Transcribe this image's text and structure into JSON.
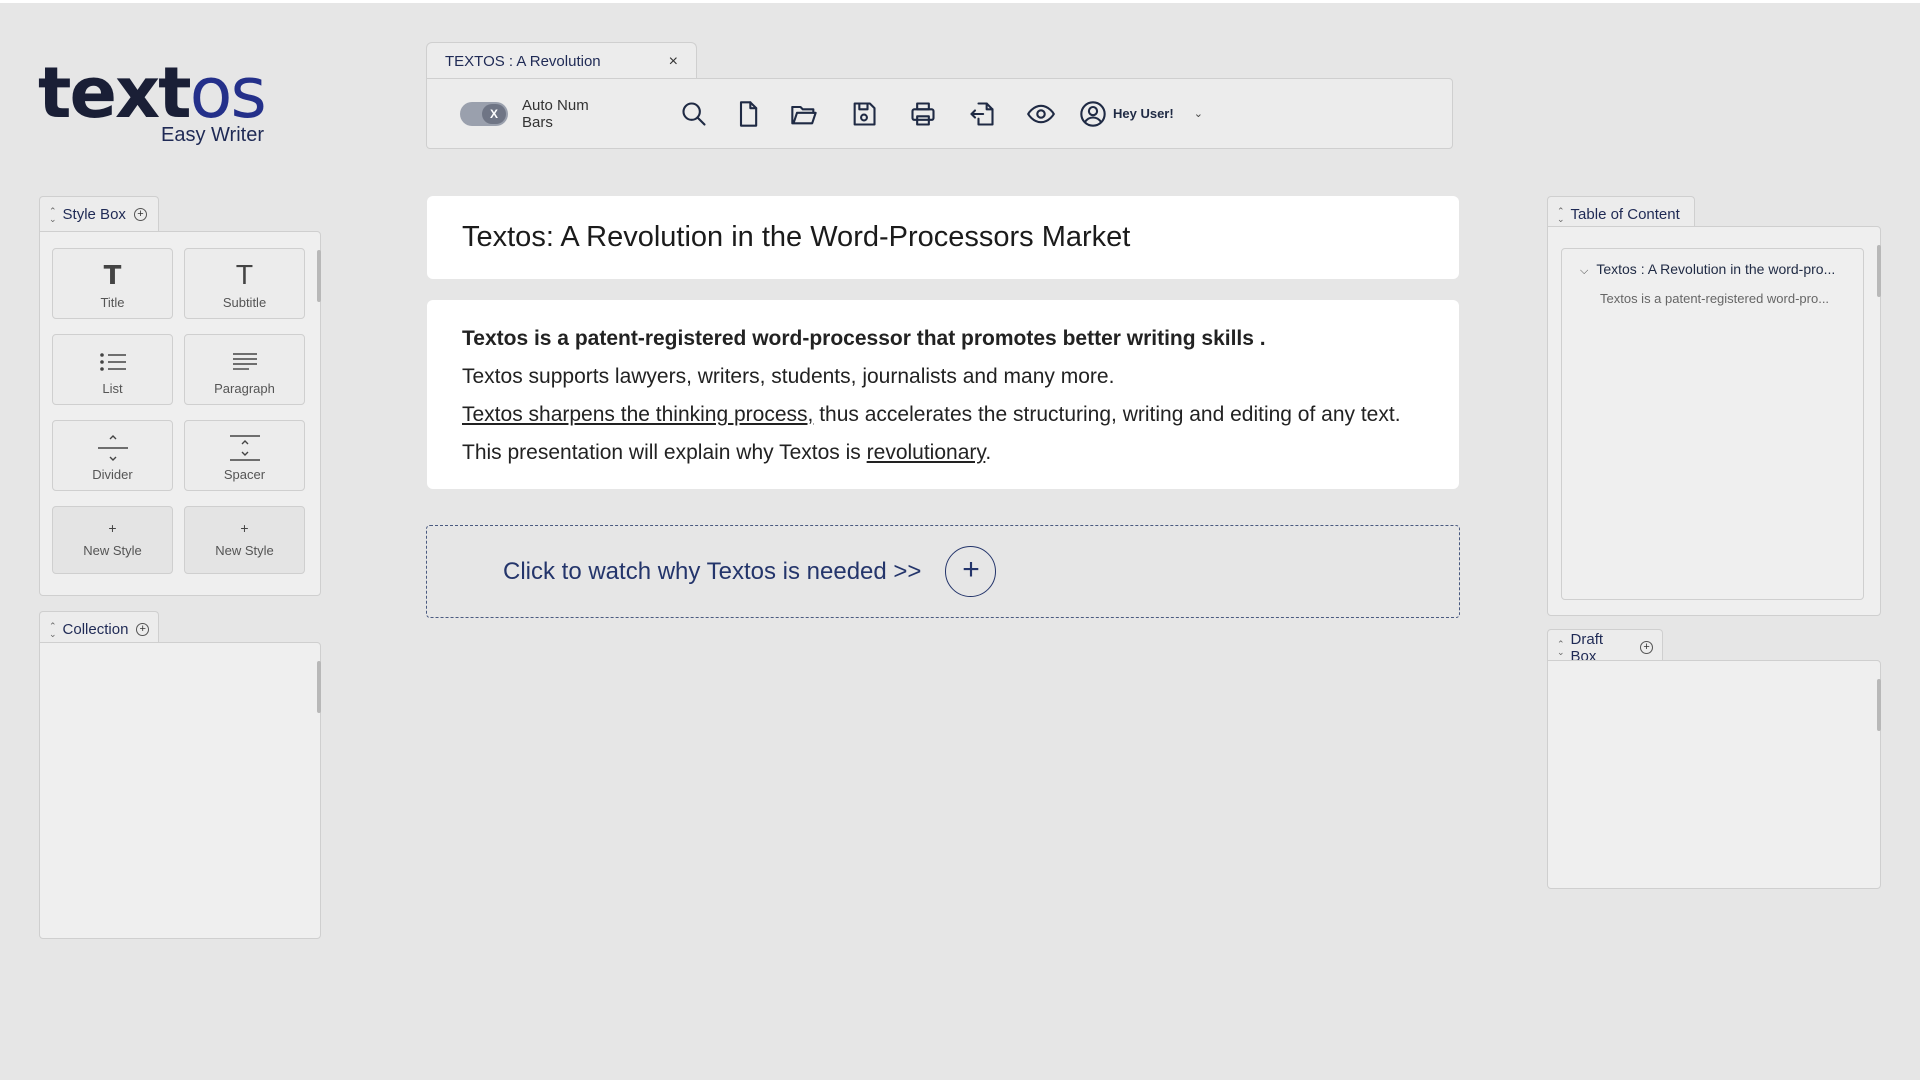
{
  "logo": {
    "word_dark": "text",
    "word_blue": "os",
    "subtitle": "Easy Writer"
  },
  "doc_tab": {
    "title": "TEXTOS : A Revolution",
    "close": "×"
  },
  "toolbar": {
    "toggle_knob": "X",
    "toggle_label": "Auto Num Bars",
    "icons": [
      "search-icon",
      "new-file-icon",
      "folder-open-icon",
      "save-icon",
      "print-icon",
      "export-icon",
      "preview-eye-icon"
    ],
    "user_name": "Hey User!",
    "user_chevron": "⌄"
  },
  "style_box": {
    "title": "Style Box",
    "buttons": [
      {
        "glyph": "T",
        "label": "Title"
      },
      {
        "glyph": "T",
        "label": "Subtitle"
      },
      {
        "label": "List"
      },
      {
        "label": "Paragraph"
      },
      {
        "label": "Divider"
      },
      {
        "label": "Spacer"
      },
      {
        "glyph": "+",
        "label": "New Style"
      },
      {
        "glyph": "+",
        "label": "New Style"
      }
    ]
  },
  "collection": {
    "title": "Collection"
  },
  "document": {
    "title": "Textos:  A Revolution in the Word-Processors Market",
    "lead": "Textos is a patent-registered word-processor that promotes better writing skills .",
    "line2": "Textos supports lawyers, writers, students, journalists and many more.",
    "line3_underlined": "Textos sharpens the thinking process,",
    "line3_rest": " thus accelerates the structuring, writing and editing of any text.",
    "line4_start": "This presentation will explain why Textos is ",
    "line4_underlined": "revolutionary",
    "line4_end": "."
  },
  "cta": {
    "text": "Click to watch why Textos is needed >>",
    "plus": "+"
  },
  "toc": {
    "title": "Table of Content",
    "item": "Textos : A Revolution in the word-pro...",
    "sub": "Textos is a patent-registered word-pro..."
  },
  "draft_box": {
    "title": "Draft Box"
  },
  "colors": {
    "background": "#e6e6e6",
    "accent": "#24356b",
    "card": "#ffffff"
  }
}
